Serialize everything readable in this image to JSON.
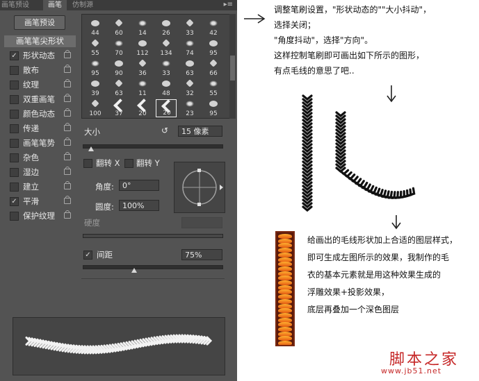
{
  "tabs": [
    {
      "label": "画笔预设",
      "active": false
    },
    {
      "label": "画笔",
      "active": true
    },
    {
      "label": "仿制源",
      "active": false
    }
  ],
  "preset_button": "画笔预设",
  "tip_header": "画笔笔尖形状",
  "options": [
    {
      "label": "形状动态",
      "checked": true
    },
    {
      "label": "散布",
      "checked": false
    },
    {
      "label": "纹理",
      "checked": false
    },
    {
      "label": "双重画笔",
      "checked": false
    },
    {
      "label": "颜色动态",
      "checked": false
    },
    {
      "label": "传递",
      "checked": false
    },
    {
      "label": "画笔笔势",
      "checked": false
    },
    {
      "label": "杂色",
      "checked": false
    },
    {
      "label": "湿边",
      "checked": false
    },
    {
      "label": "建立",
      "checked": false
    },
    {
      "label": "平滑",
      "checked": true
    },
    {
      "label": "保护纹理",
      "checked": false
    }
  ],
  "brush_grid": [
    [
      "44",
      "60",
      "14",
      "26",
      "33",
      "42"
    ],
    [
      "55",
      "70",
      "112",
      "134",
      "74",
      "95"
    ],
    [
      "95",
      "90",
      "36",
      "33",
      "63",
      "66"
    ],
    [
      "39",
      "63",
      "11",
      "48",
      "32",
      "55"
    ],
    [
      "100",
      "37",
      "20",
      "20",
      "23",
      "95"
    ]
  ],
  "selected_brush": {
    "row": 4,
    "col": 3
  },
  "size": {
    "label": "大小",
    "value": "15 像素",
    "slider": 0.06
  },
  "flip_x": "翻转 X",
  "flip_y": "翻转 Y",
  "angle": {
    "label": "角度:",
    "value": "0°"
  },
  "roundness": {
    "label": "圆度:",
    "value": "100%"
  },
  "hardness": {
    "label": "硬度",
    "value": ""
  },
  "spacing": {
    "label": "间距",
    "value": "75%",
    "checked": true,
    "slider": 0.37
  },
  "annotations": {
    "top": [
      "调整笔刷设置，\"形状动态的\"\"大小抖动\"，",
      "选择关闭；",
      "\"角度抖动\"，选择\"方向\"。",
      "这样控制笔刷即可画出如下所示的图形，",
      "有点毛线的意思了吧.."
    ],
    "bottom": [
      "给画出的毛线形状加上合适的图层样式，",
      "即可生成左图所示的效果，我制作的毛",
      "衣的基本元素就是用这种效果生成的",
      "浮雕效果+投影效果，",
      "底层再叠加一个深色图层"
    ]
  },
  "watermark": {
    "title": "脚本之家",
    "url": "www.jb51.net"
  },
  "colors": {
    "panel_bg": "#535353",
    "strip_orange": "#e45a12"
  }
}
